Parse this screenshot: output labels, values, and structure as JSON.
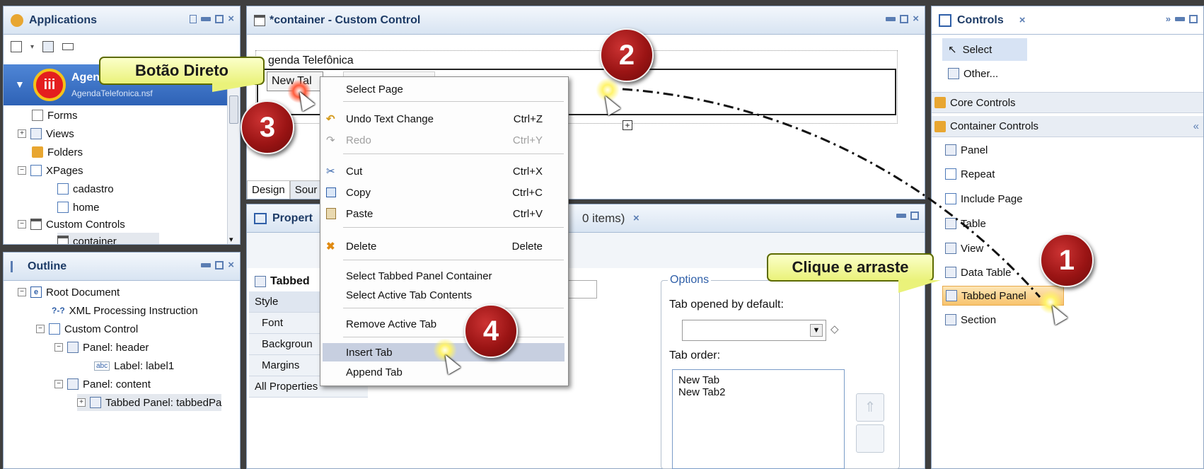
{
  "applications": {
    "title": "Applications",
    "db_name": "AgendaT",
    "db_file": "AgendaTelefonica.nsf",
    "tree": [
      "Forms",
      "Views",
      "Folders",
      "XPages",
      "cadastro",
      "home",
      "Custom Controls",
      "container"
    ]
  },
  "outline": {
    "title": "Outline",
    "tree": [
      "Root Document",
      "XML Processing Instruction",
      "Custom Control",
      "Panel: header",
      "Label: label1",
      "Panel: content",
      "Tabbed Panel: tabbedPa"
    ],
    "xml_glyph": "?-?",
    "abc_glyph": "abc"
  },
  "editor": {
    "title": "*container - Custom Control",
    "text_line": "genda Telefônica",
    "tab_label": "New Tal",
    "tabs": [
      "Design",
      "Sour"
    ]
  },
  "properties": {
    "title": "Propert",
    "items_suffix": "0 items)",
    "section": "Tabbed",
    "rows": [
      "Style",
      "Font",
      "Backgroun",
      "Margins",
      "All Properties"
    ],
    "options_legend": "Options",
    "tab_opened_label": "Tab opened by default:",
    "tab_order_label": "Tab order:",
    "tab_order_items": [
      "New Tab",
      "New Tab2"
    ]
  },
  "controls": {
    "title": "Controls",
    "select": "Select",
    "other": "Other...",
    "core": "Core Controls",
    "container": "Container Controls",
    "items": [
      "Panel",
      "Repeat",
      "Include Page",
      "Table",
      "View",
      "Data Table",
      "Tabbed Panel",
      "Section"
    ]
  },
  "context_menu": {
    "select_page": "Select Page",
    "undo": "Undo Text Change",
    "undo_sc": "Ctrl+Z",
    "redo": "Redo",
    "redo_sc": "Ctrl+Y",
    "cut": "Cut",
    "cut_sc": "Ctrl+X",
    "copy": "Copy",
    "copy_sc": "Ctrl+C",
    "paste": "Paste",
    "paste_sc": "Ctrl+V",
    "delete": "Delete",
    "delete_sc": "Delete",
    "select_container": "Select Tabbed Panel Container",
    "select_active": "Select Active Tab Contents",
    "remove_tab": "Remove Active Tab",
    "insert_tab": "Insert Tab",
    "append_tab": "Append Tab"
  },
  "annotations": {
    "callout_direct": "Botão Direto",
    "callout_drag": "Clique e arraste",
    "step1": "1",
    "step2": "2",
    "step3": "3",
    "step4": "4",
    "logo_text": "iii"
  },
  "colors": {
    "badge": "#9a1414",
    "callout": "#eaf27a",
    "selection": "#3a6fc4",
    "menu_highlight": "#c7cfe0"
  }
}
